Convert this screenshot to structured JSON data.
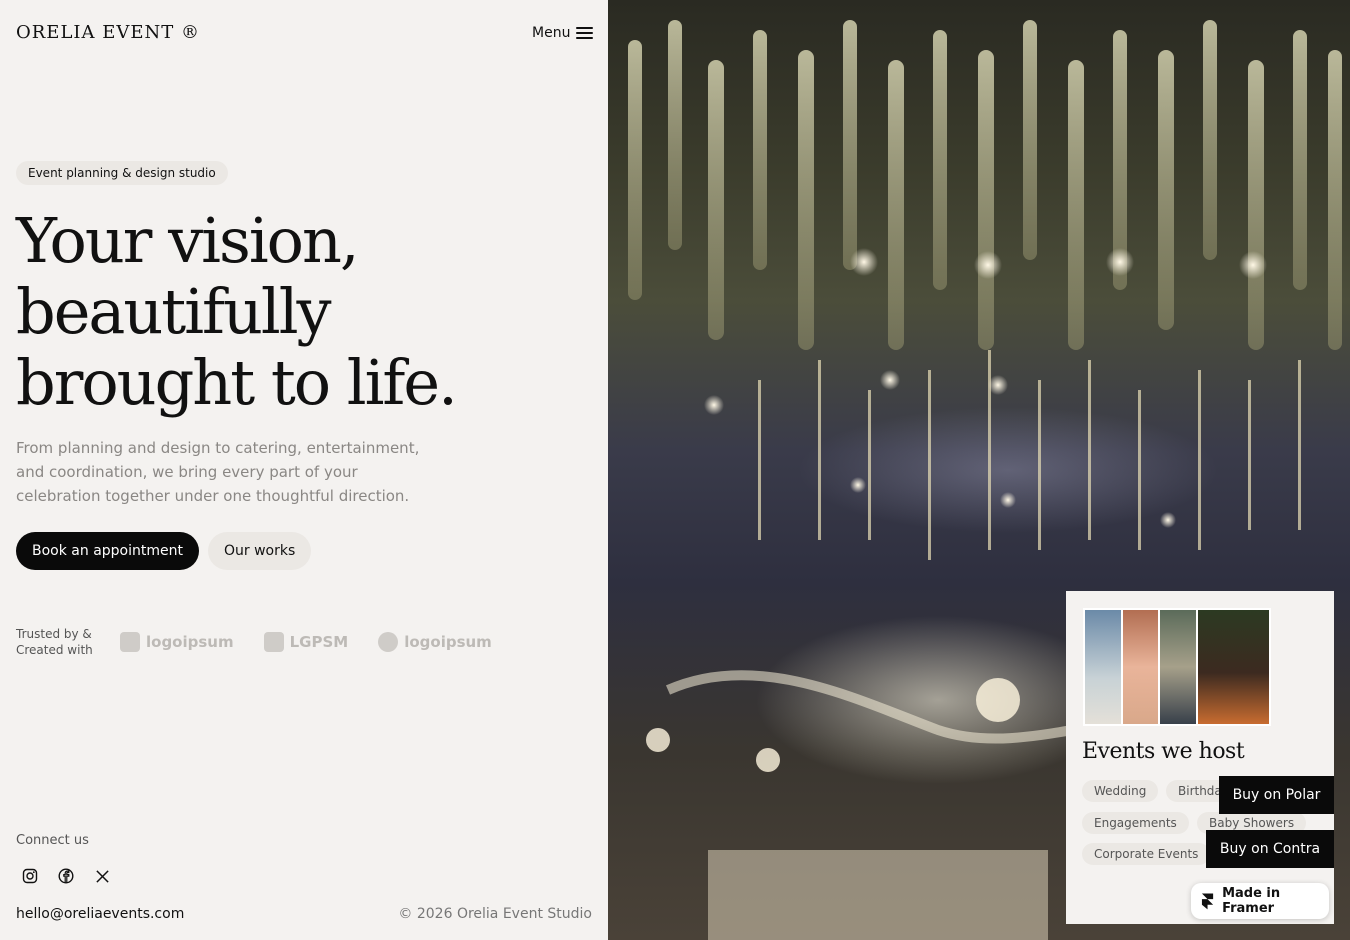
{
  "header": {
    "logo_text": "ORELIA EVENT ®",
    "menu_label": "Menu"
  },
  "hero": {
    "tag": "Event planning & design studio",
    "headline_lines": [
      "Your vision,",
      "beautifully",
      "brought to life."
    ],
    "subtitle": "From planning and design to catering, entertainment, and coordination, we bring every part of your celebration together under one thoughtful direction.",
    "cta_primary": "Book an appointment",
    "cta_secondary": "Our works"
  },
  "trusted": {
    "label": "Trusted by & Created with",
    "logos": [
      "logoipsum",
      "LGPSM",
      "logoipsum"
    ]
  },
  "footer": {
    "connect_label": "Connect us",
    "socials": [
      "instagram-icon",
      "facebook-icon",
      "x-icon"
    ],
    "email": "hello@oreliaevents.com",
    "copyright": "© 2026 Orelia Event Studio"
  },
  "events_card": {
    "title": "Events we host",
    "tags": [
      "Wedding",
      "Birthda",
      "Engagements",
      "Baby Showers",
      "Corporate Events"
    ]
  },
  "overlay_buttons": {
    "buy_polar": "Buy on Polar",
    "buy_contra": "Buy on Contra",
    "made_in_framer": "Made in Framer"
  }
}
